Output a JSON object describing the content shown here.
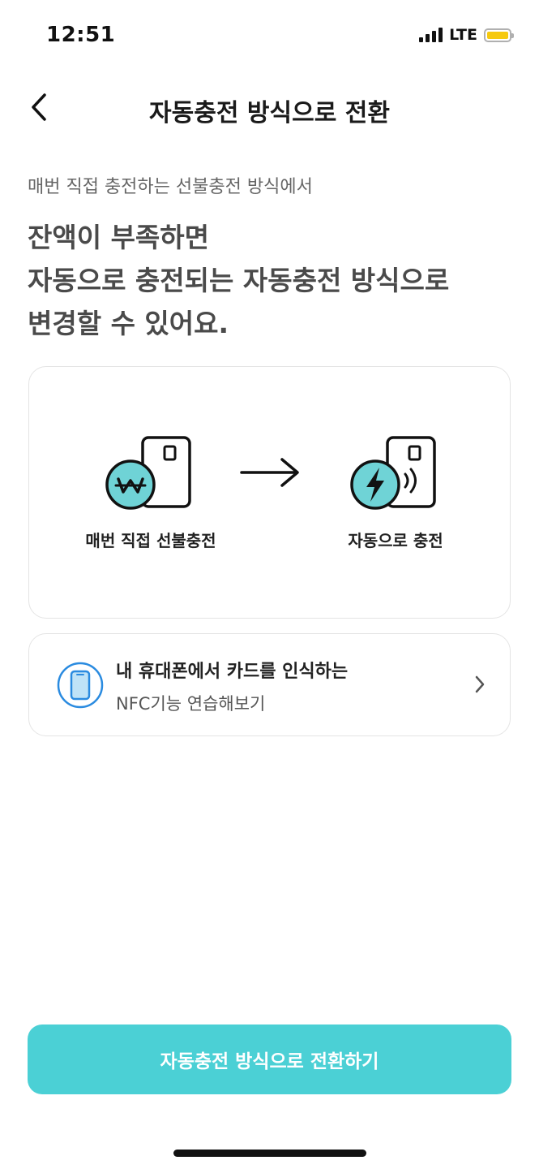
{
  "status_bar": {
    "time": "12:51",
    "network": "LTE",
    "battery_color": "#f6c90e"
  },
  "header": {
    "title": "자동충전 방식으로 전환",
    "back_icon": "chevron-left-icon"
  },
  "intro": {
    "subtitle": "매번 직접 충전하는 선불충전 방식에서",
    "headline_lines": [
      "잔액이 부족하면",
      "자동으로 충전되는 자동충전 방식으로",
      "변경할 수 있어요."
    ]
  },
  "illustration": {
    "from_label": "매번 직접 선불충전",
    "from_icon": "won-coin-card-icon",
    "arrow_icon": "arrow-right-icon",
    "to_label": "자동으로 충전",
    "to_icon": "lightning-coin-card-icon",
    "accent_color": "#6fd3d6"
  },
  "nfc_practice": {
    "title": "내 휴대폰에서 카드를 인식하는",
    "subtitle": "NFC기능 연습해보기",
    "icon": "phone-icon",
    "icon_color": "#2a8be0"
  },
  "cta": {
    "label": "자동충전 방식으로 전환하기",
    "color": "#4bd0d5"
  }
}
